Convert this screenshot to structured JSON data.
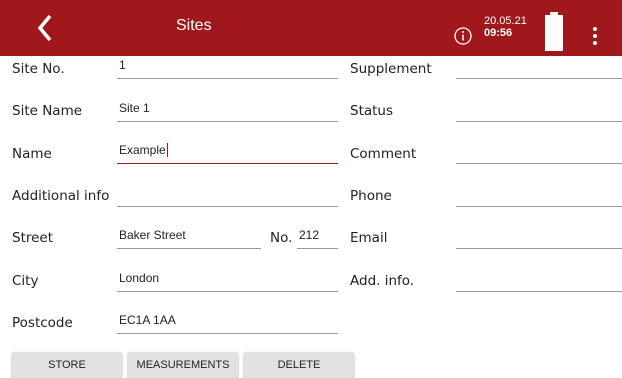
{
  "header": {
    "title": "Sites",
    "date": "20.05.21",
    "time": "09:56",
    "bar_color": "#a0181c"
  },
  "icons": {
    "back": "chevron-left-icon",
    "info": "info-icon",
    "battery": "battery-icon",
    "menu": "kebab-menu-icon"
  },
  "form": {
    "site_no": {
      "label": "Site No.",
      "value": "1"
    },
    "site_name": {
      "label": "Site Name",
      "value": "Site 1"
    },
    "name": {
      "label": "Name",
      "value": "Example"
    },
    "additional_info": {
      "label": "Additional info",
      "value": ""
    },
    "street": {
      "label": "Street",
      "value": "Baker Street"
    },
    "street_no": {
      "label": "No.",
      "value": "212"
    },
    "city": {
      "label": "City",
      "value": "London"
    },
    "postcode": {
      "label": "Postcode",
      "value": "EC1A 1AA"
    },
    "supplement": {
      "label": "Supplement",
      "value": ""
    },
    "status": {
      "label": "Status",
      "value": ""
    },
    "comment": {
      "label": "Comment",
      "value": ""
    },
    "phone": {
      "label": "Phone",
      "value": ""
    },
    "email": {
      "label": "Email",
      "value": ""
    },
    "add_info": {
      "label": "Add. info.",
      "value": ""
    }
  },
  "buttons": {
    "store": "STORE",
    "measurements": "MEASUREMENTS",
    "delete": "DELETE"
  }
}
